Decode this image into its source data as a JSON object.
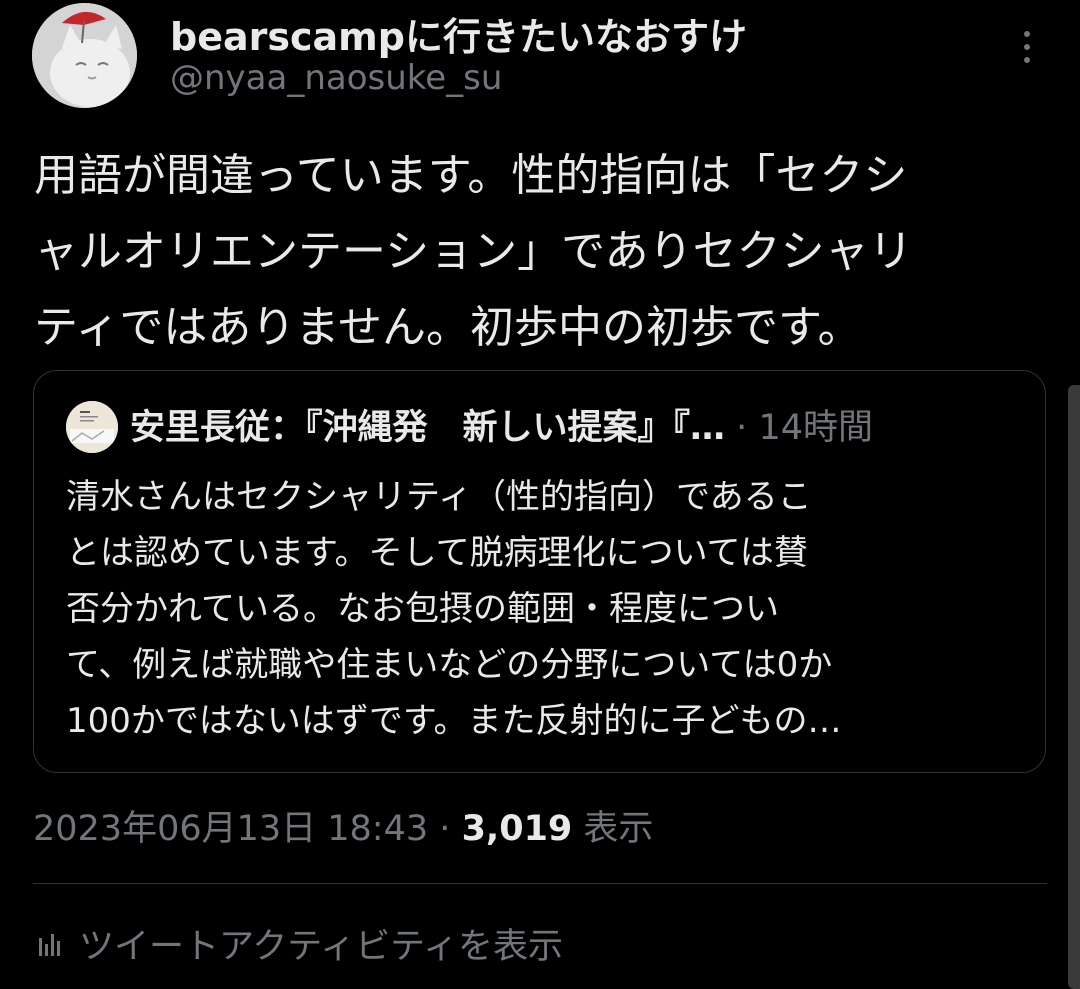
{
  "author": {
    "name": "bearscampに行きたいなおすけ",
    "handle": "@nyaa_naosuke_su",
    "avatar_icon": "cat-avatar-icon"
  },
  "more_icon": "more-dots-icon",
  "tweet": {
    "lines": [
      "用語が間違っています。性的指向は「セクシ",
      "ャルオリエンテーション」でありセクシャリ",
      "ティではありません。初歩中の初歩です。"
    ]
  },
  "quote": {
    "author_name": "安里長従：『沖縄発　新しい提案』『…",
    "separator": "·",
    "time": "14時間",
    "lines": [
      "清水さんはセクシャリティ（性的指向）であるこ",
      "とは認めています。そして脱病理化については賛",
      "否分かれている。なお包摂の範囲・程度につい",
      "て、例えば就職や住まいなどの分野については0か",
      "100かではないはずです。また反射的に子どもの…"
    ]
  },
  "meta": {
    "datetime": "2023年06月13日 18:43",
    "separator": "·",
    "views_count": "3,019",
    "views_label": "表示"
  },
  "activity": {
    "icon": "analytics-bar-icon",
    "label": "ツイートアクティビティを表示"
  },
  "colors": {
    "background": "#000000",
    "text": "#e7e9ea",
    "secondary": "#71767b",
    "border": "#2f3336"
  }
}
